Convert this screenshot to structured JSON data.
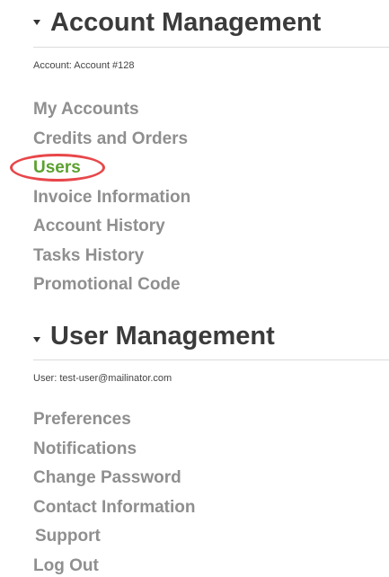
{
  "account_management": {
    "title": "Account Management",
    "context_label": "Account: Account #128",
    "items": [
      {
        "label": "My Accounts"
      },
      {
        "label": "Credits and Orders"
      },
      {
        "label": "Users"
      },
      {
        "label": "Invoice Information"
      },
      {
        "label": "Account History"
      },
      {
        "label": "Tasks History"
      },
      {
        "label": "Promotional Code"
      }
    ]
  },
  "user_management": {
    "title": "User Management",
    "context_label": "User: test-user@mailinator.com",
    "items": [
      {
        "label": "Preferences"
      },
      {
        "label": "Notifications"
      },
      {
        "label": "Change Password"
      },
      {
        "label": "Contact Information"
      },
      {
        "label": "Support"
      },
      {
        "label": "Log Out"
      }
    ]
  },
  "colors": {
    "heading": "#3b3b3b",
    "link": "#8f8f8f",
    "active_link": "#5ba12e",
    "highlight": "#e8474a",
    "rule": "#dcdcdc"
  },
  "icons": {
    "section_toggle": "caret-down-icon"
  }
}
